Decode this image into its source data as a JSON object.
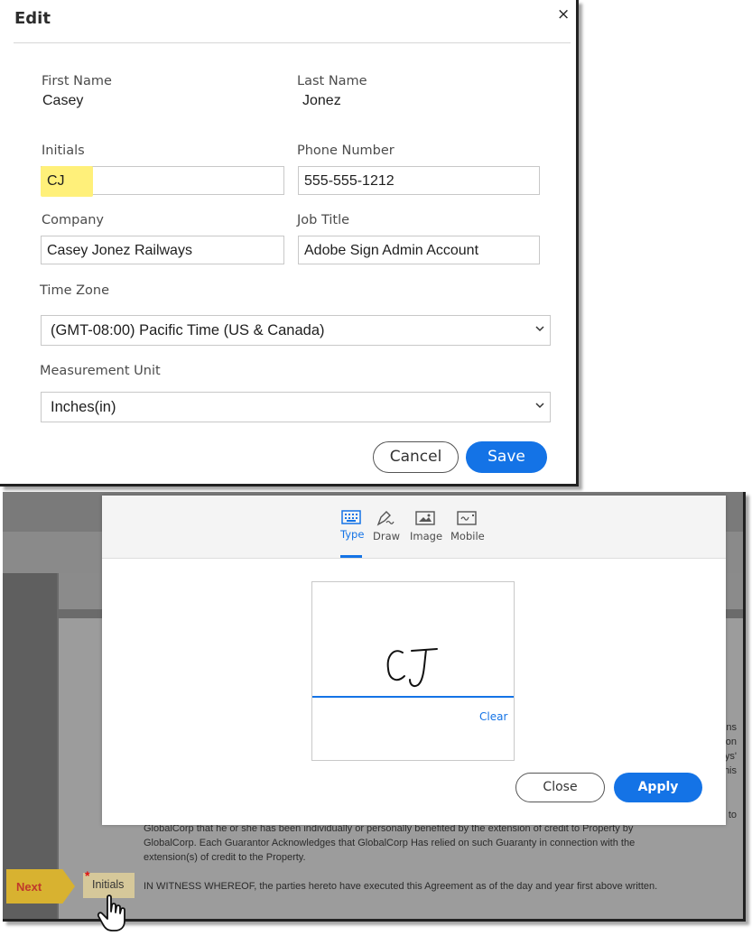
{
  "edit_dialog": {
    "title": "Edit",
    "close_glyph": "×",
    "fields": {
      "first_name": {
        "label": "First Name",
        "value": "Casey"
      },
      "last_name": {
        "label": "Last Name",
        "value": "Jonez"
      },
      "initials": {
        "label": "Initials",
        "value": "CJ"
      },
      "phone": {
        "label": "Phone Number",
        "value": "555-555-1212"
      },
      "company": {
        "label": "Company",
        "value": "Casey Jonez Railways"
      },
      "job_title": {
        "label": "Job Title",
        "value": "Adobe Sign Admin Account"
      },
      "time_zone": {
        "label": "Time Zone",
        "value": "(GMT-08:00) Pacific Time (US & Canada)"
      },
      "measurement_unit": {
        "label": "Measurement Unit",
        "value": "Inches(in)"
      }
    },
    "cancel_label": "Cancel",
    "save_label": "Save",
    "highlight_color": "#fff07a"
  },
  "signature_modal": {
    "tabs": [
      {
        "label": "Type",
        "icon": "keyboard-icon",
        "active": true
      },
      {
        "label": "Draw",
        "icon": "pen-icon",
        "active": false
      },
      {
        "label": "Image",
        "icon": "image-icon",
        "active": false
      },
      {
        "label": "Mobile",
        "icon": "mobile-icon",
        "active": false
      }
    ],
    "signature_text": "CJ",
    "clear_label": "Clear",
    "close_label": "Close",
    "apply_label": "Apply",
    "accent_color": "#1473e6"
  },
  "document": {
    "side_fragments": [
      "ns",
      "on",
      "ys'",
      "his",
      "to"
    ],
    "paragraph_lines": [
      "GlobalCorp that he or she has been individually or personally benefited by the extension of credit to Property by",
      "GlobalCorp. Each Guarantor Acknowledges that GlobalCorp Has relied on such Guaranty in connection with the",
      "extension(s) of credit to the Property."
    ],
    "witness_line": "IN WITNESS WHEREOF, the parties hereto have executed this Agreement as of the day and year first above written.",
    "next_label": "Next",
    "initials_field_label": "Initials",
    "required_mark": "*"
  }
}
